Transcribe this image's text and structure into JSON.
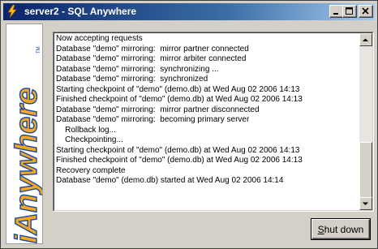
{
  "window": {
    "title": "server2 - SQL Anywhere"
  },
  "logo": {
    "text": "iAnywhere",
    "tm": "TM"
  },
  "log": {
    "lines": [
      "Now accepting requests",
      "Database \"demo\" mirroring:  mirror partner connected",
      "Database \"demo\" mirroring:  mirror arbiter connected",
      "Database \"demo\" mirroring:  synchronizing ...",
      "Database \"demo\" mirroring:  synchronized",
      "Starting checkpoint of \"demo\" (demo.db) at Wed Aug 02 2006 14:13",
      "Finished checkpoint of \"demo\" (demo.db) at Wed Aug 02 2006 14:13",
      "Database \"demo\" mirroring:  mirror partner disconnected",
      "Database \"demo\" mirroring:  becoming primary server",
      "    Rollback log...",
      "    Checkpointing...",
      "Starting checkpoint of \"demo\" (demo.db) at Wed Aug 02 2006 14:13",
      "Finished checkpoint of \"demo\" (demo.db) at Wed Aug 02 2006 14:13",
      "Recovery complete",
      "Database \"demo\" (demo.db) started at Wed Aug 02 2006 14:14"
    ]
  },
  "buttons": {
    "shutdown_label": "Shut down",
    "shutdown_mnemonic": "S",
    "shutdown_rest": "hut down"
  },
  "colors": {
    "titlebar": "#0a246a",
    "logo_orange": "#f5a623",
    "logo_blue": "#1a4a9e"
  },
  "icons": {
    "app": "lightning-icon",
    "minimize": "minimize-icon",
    "maximize": "maximize-icon",
    "close": "close-icon"
  }
}
